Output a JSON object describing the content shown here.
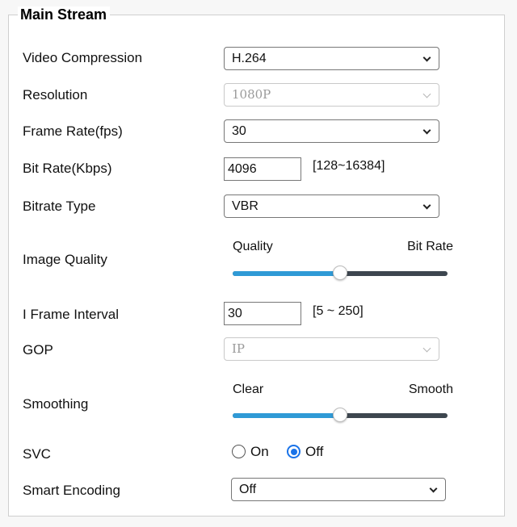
{
  "section": {
    "title": "Main Stream"
  },
  "video_compression": {
    "label": "Video Compression",
    "value": "H.264"
  },
  "resolution": {
    "label": "Resolution",
    "value": "1080P",
    "disabled": true
  },
  "frame_rate": {
    "label": "Frame Rate(fps)",
    "value": "30"
  },
  "bit_rate": {
    "label": "Bit Rate(Kbps)",
    "value": "4096",
    "range": "[128~16384]"
  },
  "bitrate_type": {
    "label": "Bitrate Type",
    "value": "VBR"
  },
  "image_quality": {
    "label": "Image Quality",
    "left_caption": "Quality",
    "right_caption": "Bit Rate",
    "level": 0.5
  },
  "i_frame_interval": {
    "label": "I Frame Interval",
    "value": "30",
    "range": "[5 ~ 250]"
  },
  "gop": {
    "label": "GOP",
    "value": "IP",
    "disabled": true
  },
  "smoothing": {
    "label": "Smoothing",
    "left_caption": "Clear",
    "right_caption": "Smooth",
    "level": 0.5
  },
  "svc": {
    "label": "SVC",
    "options": [
      {
        "label": "On",
        "checked": false
      },
      {
        "label": "Off",
        "checked": true
      }
    ]
  },
  "smart_encoding": {
    "label": "Smart Encoding",
    "value": "Off"
  },
  "colors": {
    "accent": "#2f9ad6",
    "radio_selected": "#1a73e8",
    "track": "#3d464f"
  }
}
